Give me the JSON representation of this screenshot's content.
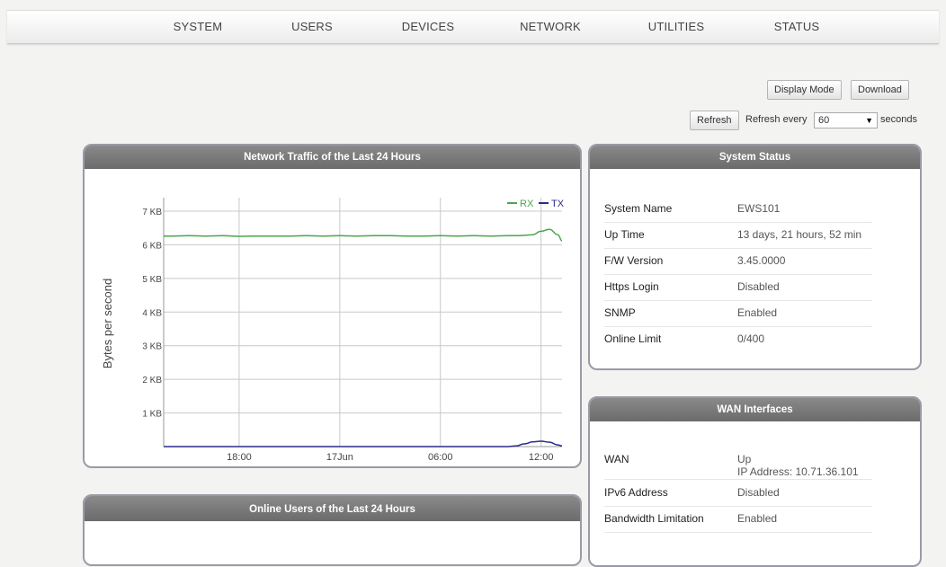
{
  "nav": {
    "items": [
      "SYSTEM",
      "USERS",
      "DEVICES",
      "NETWORK",
      "UTILITIES",
      "STATUS"
    ]
  },
  "toolbar": {
    "display_mode": "Display Mode",
    "download": "Download",
    "refresh": "Refresh",
    "refresh_every": "Refresh every",
    "refresh_interval": "60",
    "seconds": "seconds"
  },
  "traffic_panel": {
    "title": "Network Traffic of the Last 24 Hours"
  },
  "online_users_panel": {
    "title": "Online Users of the Last 24 Hours"
  },
  "system_status": {
    "title": "System Status",
    "rows": [
      {
        "label": "System Name",
        "value": "EWS101"
      },
      {
        "label": "Up Time",
        "value": "13 days, 21 hours, 52 min"
      },
      {
        "label": "F/W Version",
        "value": "3.45.0000"
      },
      {
        "label": "Https Login",
        "value": "Disabled"
      },
      {
        "label": "SNMP",
        "value": "Enabled"
      },
      {
        "label": "Online Limit",
        "value": "0/400"
      }
    ]
  },
  "wan_interfaces": {
    "title": "WAN Interfaces",
    "wan_label": "WAN",
    "wan_status": "Up",
    "wan_ip": "IP Address: 10.71.36.101",
    "rows": [
      {
        "label": "IPv6 Address",
        "value": "Disabled"
      },
      {
        "label": "Bandwidth Limitation",
        "value": "Enabled"
      }
    ]
  },
  "chart_data": {
    "type": "line",
    "ylabel": "Bytes per second",
    "y_ticks": [
      "1 KB",
      "2 KB",
      "3 KB",
      "4 KB",
      "5 KB",
      "6 KB",
      "7 KB"
    ],
    "ylim": [
      0,
      7.4
    ],
    "y_unit": "KB",
    "x_ticks": [
      "18:00",
      "17Jun",
      "06:00",
      "12:00"
    ],
    "legend": [
      "RX",
      "TX"
    ],
    "legend_position": "top-right",
    "grid": true,
    "series": [
      {
        "name": "RX",
        "color": "#4aa64a",
        "x": [
          "13:30",
          "14:00",
          "15:00",
          "16:00",
          "17:00",
          "18:00",
          "19:00",
          "20:00",
          "21:00",
          "22:00",
          "23:00",
          "00:00",
          "01:00",
          "02:00",
          "03:00",
          "04:00",
          "05:00",
          "06:00",
          "07:00",
          "08:00",
          "09:00",
          "10:00",
          "10:30",
          "11:00",
          "11:30",
          "12:00",
          "12:30",
          "13:00",
          "13:15"
        ],
        "values": [
          6.26,
          6.26,
          6.27,
          6.26,
          6.27,
          6.25,
          6.26,
          6.26,
          6.26,
          6.27,
          6.26,
          6.27,
          6.26,
          6.27,
          6.27,
          6.26,
          6.26,
          6.27,
          6.26,
          6.27,
          6.26,
          6.27,
          6.27,
          6.28,
          6.3,
          6.4,
          6.46,
          6.3,
          6.12
        ]
      },
      {
        "name": "TX",
        "color": "#2b2b8c",
        "x": [
          "13:30",
          "18:00",
          "00:00",
          "06:00",
          "10:00",
          "10:30",
          "11:00",
          "11:30",
          "12:00",
          "12:30",
          "13:00",
          "13:15"
        ],
        "values": [
          0,
          0,
          0,
          0,
          0,
          0.02,
          0.08,
          0.14,
          0.16,
          0.13,
          0.05,
          0.02
        ]
      }
    ]
  }
}
